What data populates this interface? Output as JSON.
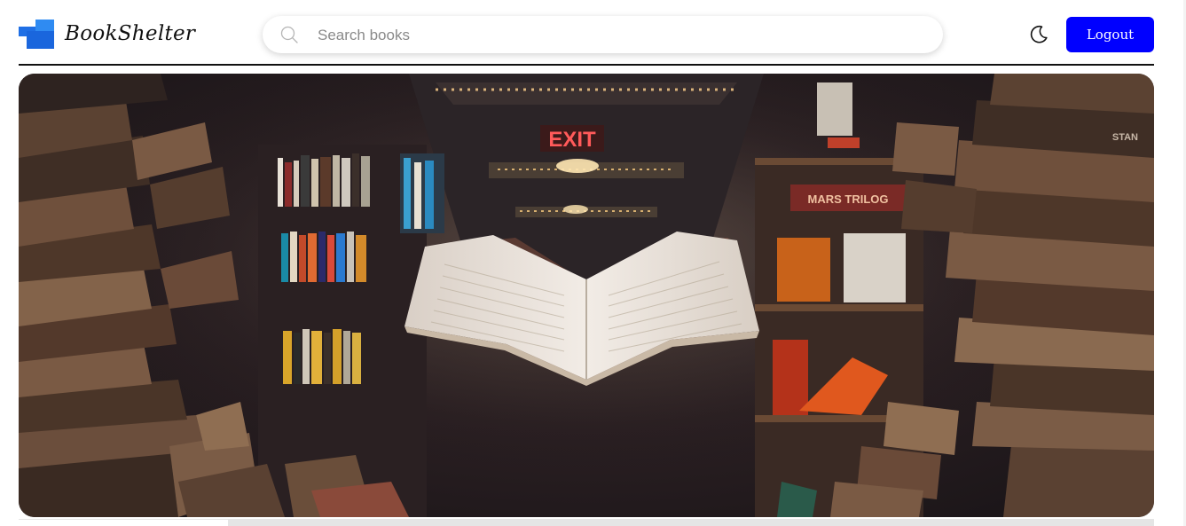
{
  "app": {
    "brand": "BookShelter",
    "brand_color": "#1f6fe5"
  },
  "header": {
    "search": {
      "placeholder": "Search books",
      "value": "",
      "icon": "search-icon"
    },
    "theme_toggle": {
      "icon": "moon-icon"
    },
    "logout_label": "Logout",
    "logout_color": "#0000ff"
  },
  "hero": {
    "image": "library-with-open-book",
    "sign_text": "EXIT",
    "shelf_text": "MARS TRILOG",
    "spine_text": "STAN"
  }
}
